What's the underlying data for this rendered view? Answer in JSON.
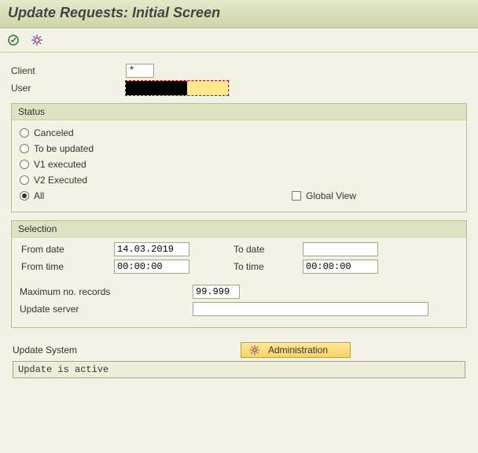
{
  "title": "Update Requests: Initial Screen",
  "fields": {
    "client_label": "Client",
    "client_value": "*",
    "user_label": "User",
    "user_value": ""
  },
  "status": {
    "title": "Status",
    "options": {
      "canceled": "Canceled",
      "to_be_updated": "To be updated",
      "v1": "V1 executed",
      "v2": "V2 Executed",
      "all": "All"
    },
    "selected": "all",
    "global_view_label": "Global View"
  },
  "selection": {
    "title": "Selection",
    "from_date_label": "From date",
    "from_date": "14.03.2019",
    "to_date_label": "To date",
    "to_date": "",
    "from_time_label": "From time",
    "from_time": "00:00:00",
    "to_time_label": "To time",
    "to_time": "00:00:00",
    "max_label": "Maximum no. records",
    "max_value": "99.999",
    "server_label": "Update server",
    "server_value": ""
  },
  "system": {
    "label": "Update System",
    "admin_button": "Administration",
    "status_text": "Update is active"
  },
  "icons": {
    "execute": "execute-icon",
    "admin": "admin-gear-icon"
  }
}
